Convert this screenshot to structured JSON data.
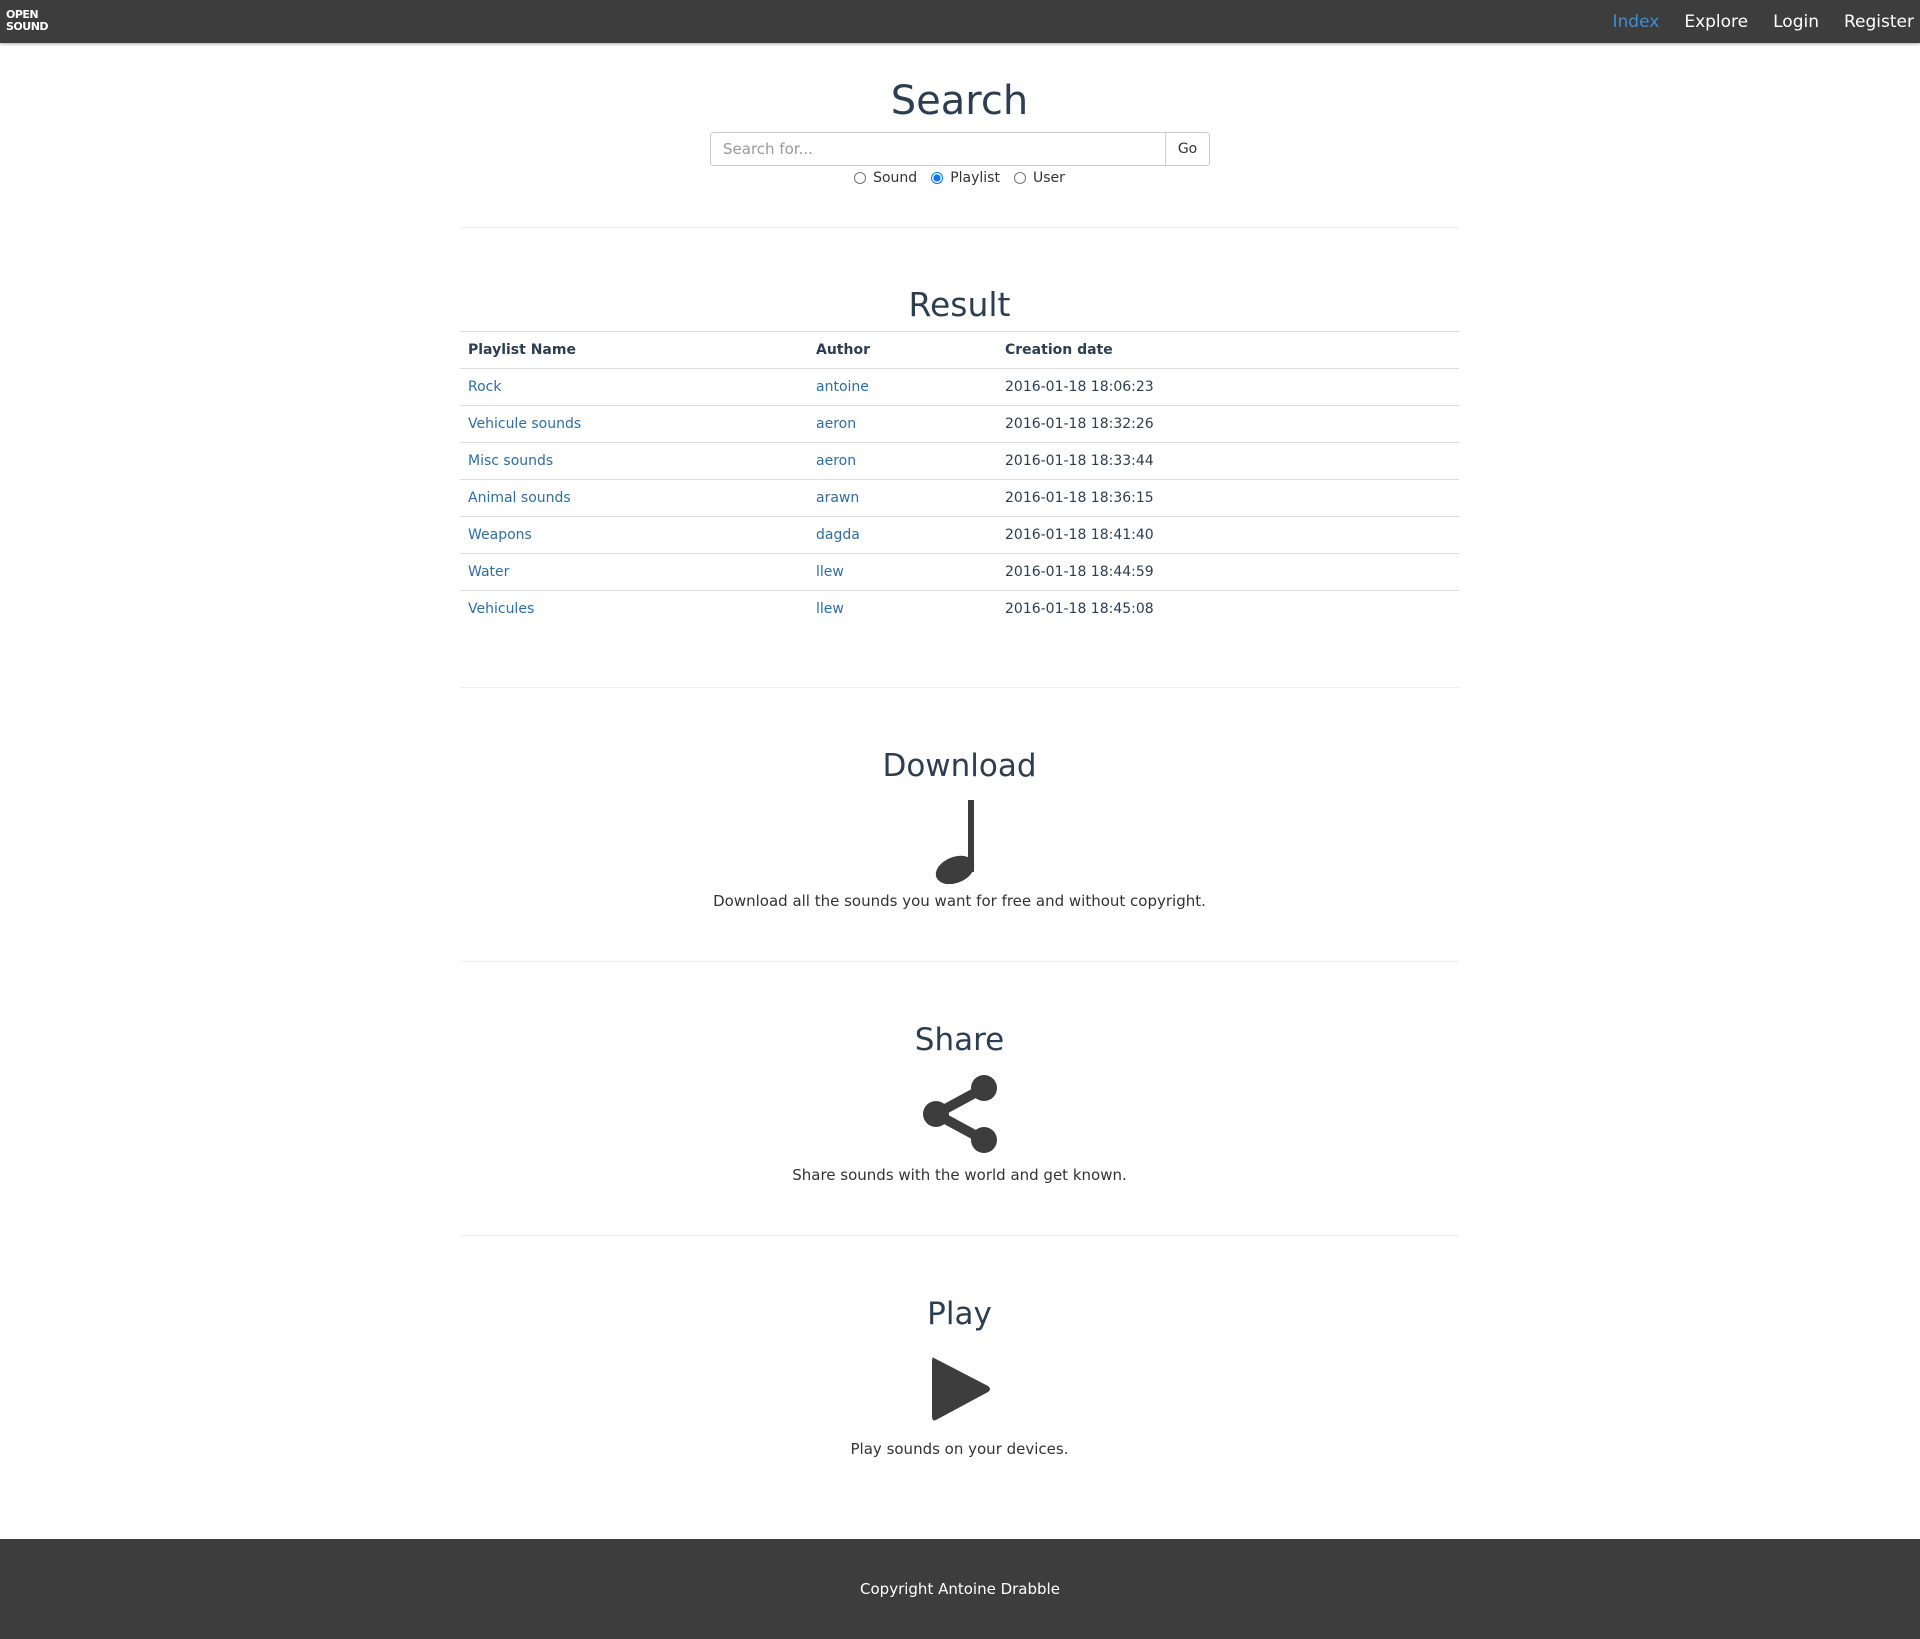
{
  "navbar": {
    "brand_line1": "OPEN",
    "brand_line2": "SOUND",
    "links": [
      {
        "label": "Index",
        "active": true
      },
      {
        "label": "Explore",
        "active": false
      },
      {
        "label": "Login",
        "active": false
      },
      {
        "label": "Register",
        "active": false
      }
    ]
  },
  "search": {
    "title": "Search",
    "placeholder": "Search for...",
    "value": "",
    "go_label": "Go",
    "types": [
      {
        "label": "Sound",
        "checked": false
      },
      {
        "label": "Playlist",
        "checked": true
      },
      {
        "label": "User",
        "checked": false
      }
    ]
  },
  "result": {
    "title": "Result",
    "columns": [
      "Playlist Name",
      "Author",
      "Creation date"
    ],
    "rows": [
      {
        "name": "Rock",
        "author": "antoine",
        "date": "2016-01-18 18:06:23"
      },
      {
        "name": "Vehicule sounds",
        "author": "aeron",
        "date": "2016-01-18 18:32:26"
      },
      {
        "name": "Misc sounds",
        "author": "aeron",
        "date": "2016-01-18 18:33:44"
      },
      {
        "name": "Animal sounds",
        "author": "arawn",
        "date": "2016-01-18 18:36:15"
      },
      {
        "name": "Weapons",
        "author": "dagda",
        "date": "2016-01-18 18:41:40"
      },
      {
        "name": "Water",
        "author": "llew",
        "date": "2016-01-18 18:44:59"
      },
      {
        "name": "Vehicules",
        "author": "llew",
        "date": "2016-01-18 18:45:08"
      }
    ]
  },
  "features": {
    "download": {
      "title": "Download",
      "icon": "music-note-icon",
      "text": "Download all the sounds you want for free and without copyright."
    },
    "share": {
      "title": "Share",
      "icon": "share-icon",
      "text": "Share sounds with the world and get known."
    },
    "play": {
      "title": "Play",
      "icon": "play-icon",
      "text": "Play sounds on your devices."
    }
  },
  "footer": {
    "text": "Copyright Antoine Drabble"
  },
  "colors": {
    "navbar_bg": "#3d3d3d",
    "active_link": "#3b8fd6",
    "table_link": "#2f6da3",
    "heading": "#2c3e50",
    "icon": "#3d3d3d"
  }
}
